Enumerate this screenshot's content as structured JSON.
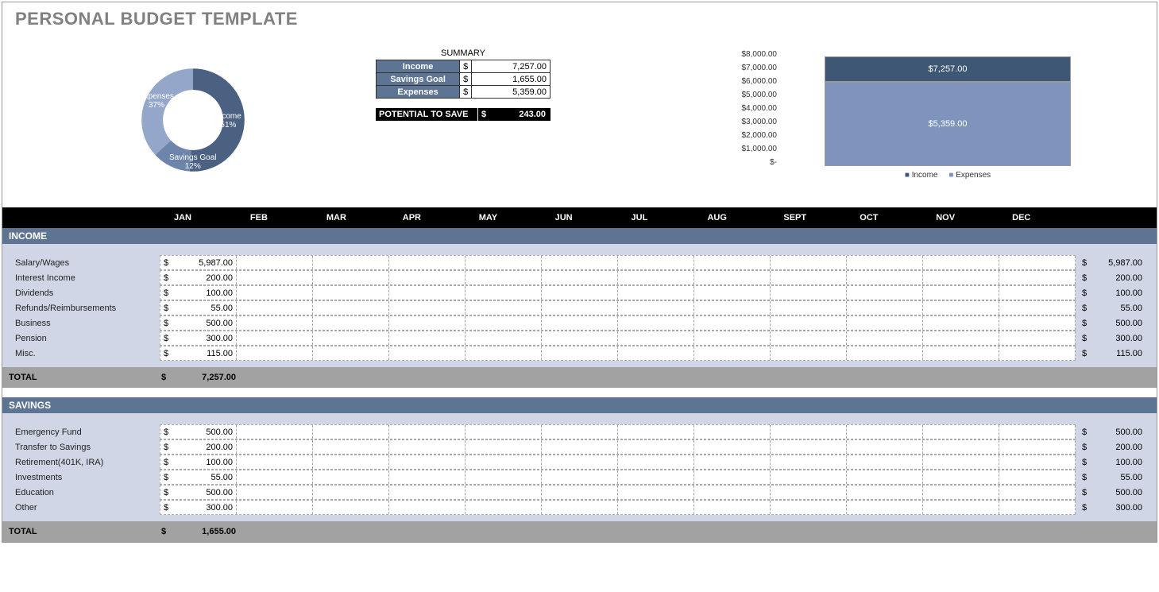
{
  "title": "PERSONAL BUDGET TEMPLATE",
  "donut": {
    "income": {
      "label": "Income",
      "pct": "51%"
    },
    "savings": {
      "label": "Savings Goal",
      "pct": "12%"
    },
    "expenses": {
      "label": "Expenses",
      "pct": "37%"
    }
  },
  "summary": {
    "heading": "SUMMARY",
    "rows": {
      "income": {
        "label": "Income",
        "cur": "$",
        "value": "7,257.00"
      },
      "savings": {
        "label": "Savings Goal",
        "cur": "$",
        "value": "1,655.00"
      },
      "expenses": {
        "label": "Expenses",
        "cur": "$",
        "value": "5,359.00"
      }
    },
    "potential": {
      "label": "POTENTIAL TO SAVE",
      "cur": "$",
      "value": "243.00"
    }
  },
  "axis_ticks": [
    "$8,000.00",
    "$7,000.00",
    "$6,000.00",
    "$5,000.00",
    "$4,000.00",
    "$3,000.00",
    "$2,000.00",
    "$1,000.00",
    "$-"
  ],
  "bars": {
    "income": {
      "label": "$7,257.00"
    },
    "expenses": {
      "label": "$5,359.00"
    },
    "legend": {
      "a": "Income",
      "b": "Expenses"
    }
  },
  "months": [
    "JAN",
    "FEB",
    "MAR",
    "APR",
    "MAY",
    "JUN",
    "JUL",
    "AUG",
    "SEPT",
    "OCT",
    "NOV",
    "DEC"
  ],
  "sections": {
    "income": {
      "title": "INCOME",
      "rows": [
        {
          "label": "Salary/Wages",
          "jan": "5,987.00",
          "total": "5,987.00"
        },
        {
          "label": "Interest Income",
          "jan": "200.00",
          "total": "200.00"
        },
        {
          "label": "Dividends",
          "jan": "100.00",
          "total": "100.00"
        },
        {
          "label": "Refunds/Reimbursements",
          "jan": "55.00",
          "total": "55.00"
        },
        {
          "label": "Business",
          "jan": "500.00",
          "total": "500.00"
        },
        {
          "label": "Pension",
          "jan": "300.00",
          "total": "300.00"
        },
        {
          "label": "Misc.",
          "jan": "115.00",
          "total": "115.00"
        }
      ],
      "total": {
        "label": "TOTAL",
        "cur": "$",
        "value": "7,257.00"
      }
    },
    "savings": {
      "title": "SAVINGS",
      "rows": [
        {
          "label": "Emergency Fund",
          "jan": "500.00",
          "total": "500.00"
        },
        {
          "label": "Transfer to Savings",
          "jan": "200.00",
          "total": "200.00"
        },
        {
          "label": "Retirement(401K, IRA)",
          "jan": "100.00",
          "total": "100.00"
        },
        {
          "label": "Investments",
          "jan": "55.00",
          "total": "55.00"
        },
        {
          "label": "Education",
          "jan": "500.00",
          "total": "500.00"
        },
        {
          "label": "Other",
          "jan": "300.00",
          "total": "300.00"
        }
      ],
      "total": {
        "label": "TOTAL",
        "cur": "$",
        "value": "1,655.00"
      }
    }
  },
  "cur": "$",
  "chart_data": [
    {
      "type": "pie",
      "title": "",
      "series": [
        {
          "name": "Income",
          "value": 51
        },
        {
          "name": "Savings Goal",
          "value": 12
        },
        {
          "name": "Expenses",
          "value": 37
        }
      ],
      "unit": "percent"
    },
    {
      "type": "bar",
      "categories": [
        "Income",
        "Expenses"
      ],
      "values": [
        7257.0,
        5359.0
      ],
      "ylabel": "$",
      "ylim": [
        0,
        8000
      ],
      "title": ""
    }
  ]
}
